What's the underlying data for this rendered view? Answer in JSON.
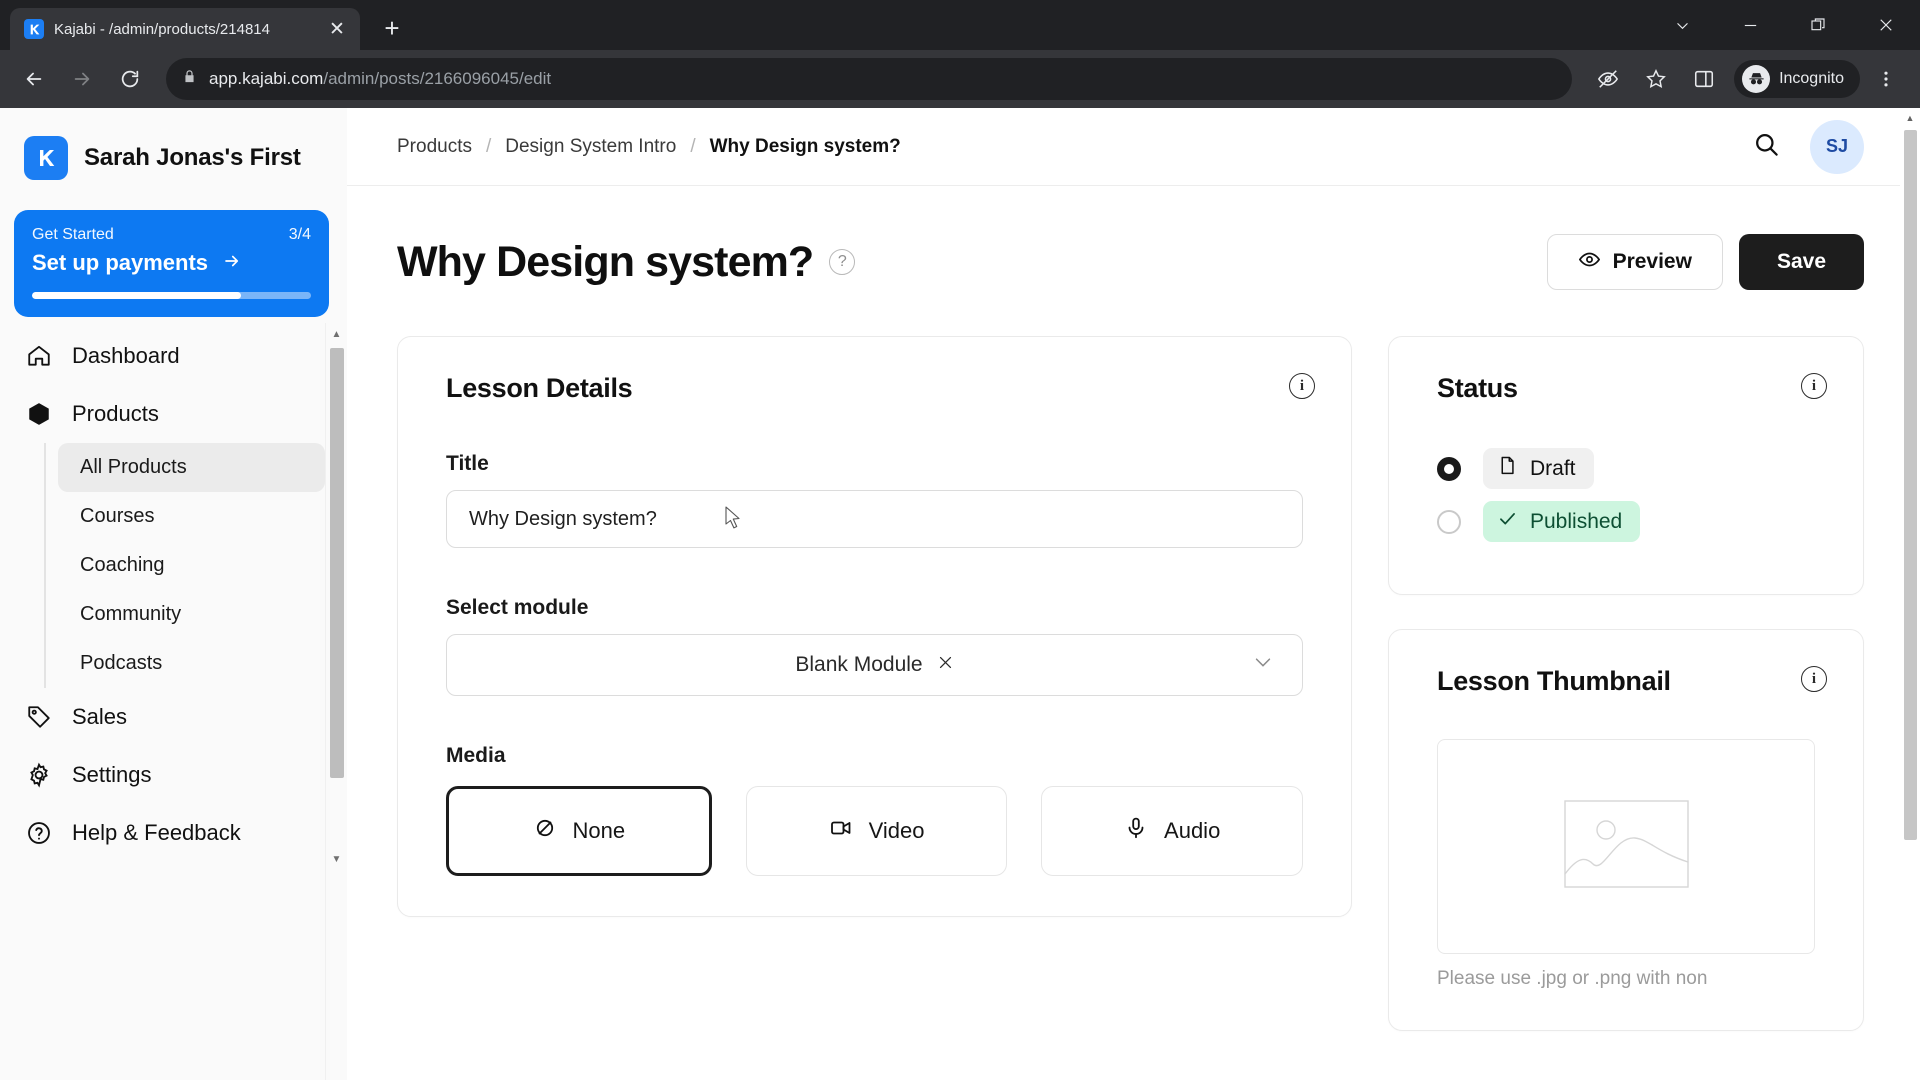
{
  "browser": {
    "tab": {
      "title": "Kajabi - /admin/products/214814",
      "favicon": "kajabi-logo-icon",
      "close_label": "✕"
    },
    "new_tab_label": "+",
    "window_controls": {
      "minimize": "–",
      "restore": "❐",
      "close": "✕",
      "chevron": "∨"
    },
    "nav": {
      "back": "←",
      "forward": "→",
      "reload": "↻"
    },
    "omnibox": {
      "lock_icon": "padlock-icon",
      "url_domain": "app.kajabi.com",
      "url_path": "/admin/posts/2166096045/edit",
      "full_url": "app.kajabi.com/admin/posts/2166096045/edit"
    },
    "omni_actions": {
      "third_party_cookie": "eye-slash-icon",
      "bookmark": "star-icon",
      "side_panel": "side-panel-icon",
      "menu": "three-dot-menu-icon"
    },
    "profile": {
      "label": "Incognito",
      "icon": "incognito-hat-icon"
    }
  },
  "sidebar": {
    "brand": {
      "name": "Sarah Jonas's First",
      "logo": "kajabi-logo-icon"
    },
    "get_started": {
      "label": "Get Started",
      "count": "3/4",
      "action": "Set up payments",
      "arrow": "→",
      "progress_percent": 75
    },
    "nav": [
      {
        "label": "Dashboard",
        "icon": "home-icon",
        "active": false
      },
      {
        "label": "Products",
        "icon": "box-icon",
        "active": true
      },
      {
        "label": "Sales",
        "icon": "tag-icon",
        "active": false
      },
      {
        "label": "Settings",
        "icon": "gear-icon",
        "active": false
      },
      {
        "label": "Help & Feedback",
        "icon": "question-circle-icon",
        "active": false
      }
    ],
    "subnav": [
      {
        "label": "All Products",
        "active": true
      },
      {
        "label": "Courses",
        "active": false
      },
      {
        "label": "Coaching",
        "active": false
      },
      {
        "label": "Community",
        "active": false
      },
      {
        "label": "Podcasts",
        "active": false
      }
    ]
  },
  "topbar": {
    "breadcrumbs": [
      {
        "label": "Products",
        "current": false
      },
      {
        "label": "Design System Intro",
        "current": false
      },
      {
        "label": "Why Design system?",
        "current": true
      }
    ],
    "separator": "/",
    "search_icon": "search-icon",
    "avatar_initials": "SJ"
  },
  "page_head": {
    "title": "Why Design system?",
    "help_icon": "question-mark-icon",
    "help_glyph": "?",
    "preview_label": "Preview",
    "preview_icon": "eye-icon",
    "save_label": "Save"
  },
  "lesson_details": {
    "card_title": "Lesson Details",
    "info_glyph": "i",
    "title_label": "Title",
    "title_value": "Why Design system?",
    "module_label": "Select module",
    "module_value": "Blank Module",
    "module_clear": "✕",
    "module_chevron": "∨",
    "media_label": "Media",
    "media_options": [
      {
        "label": "None",
        "icon": "eye-slash-icon",
        "selected": true
      },
      {
        "label": "Video",
        "icon": "video-camera-icon",
        "selected": false
      },
      {
        "label": "Audio",
        "icon": "microphone-icon",
        "selected": false
      }
    ]
  },
  "status_card": {
    "card_title": "Status",
    "info_glyph": "i",
    "options": [
      {
        "label": "Draft",
        "icon": "document-icon",
        "selected": true
      },
      {
        "label": "Published",
        "icon": "check-icon",
        "selected": false
      }
    ]
  },
  "thumbnail_card": {
    "card_title": "Lesson Thumbnail",
    "info_glyph": "i",
    "placeholder_icon": "image-placeholder-icon",
    "note": "Please use .jpg or .png with non"
  },
  "colors": {
    "brand_blue": "#0d79f2",
    "accent_dark": "#1d1d1d",
    "published_green": "#cdf5df",
    "draft_gray": "#f0f0f0",
    "avatar_bg": "#dbeafe"
  }
}
